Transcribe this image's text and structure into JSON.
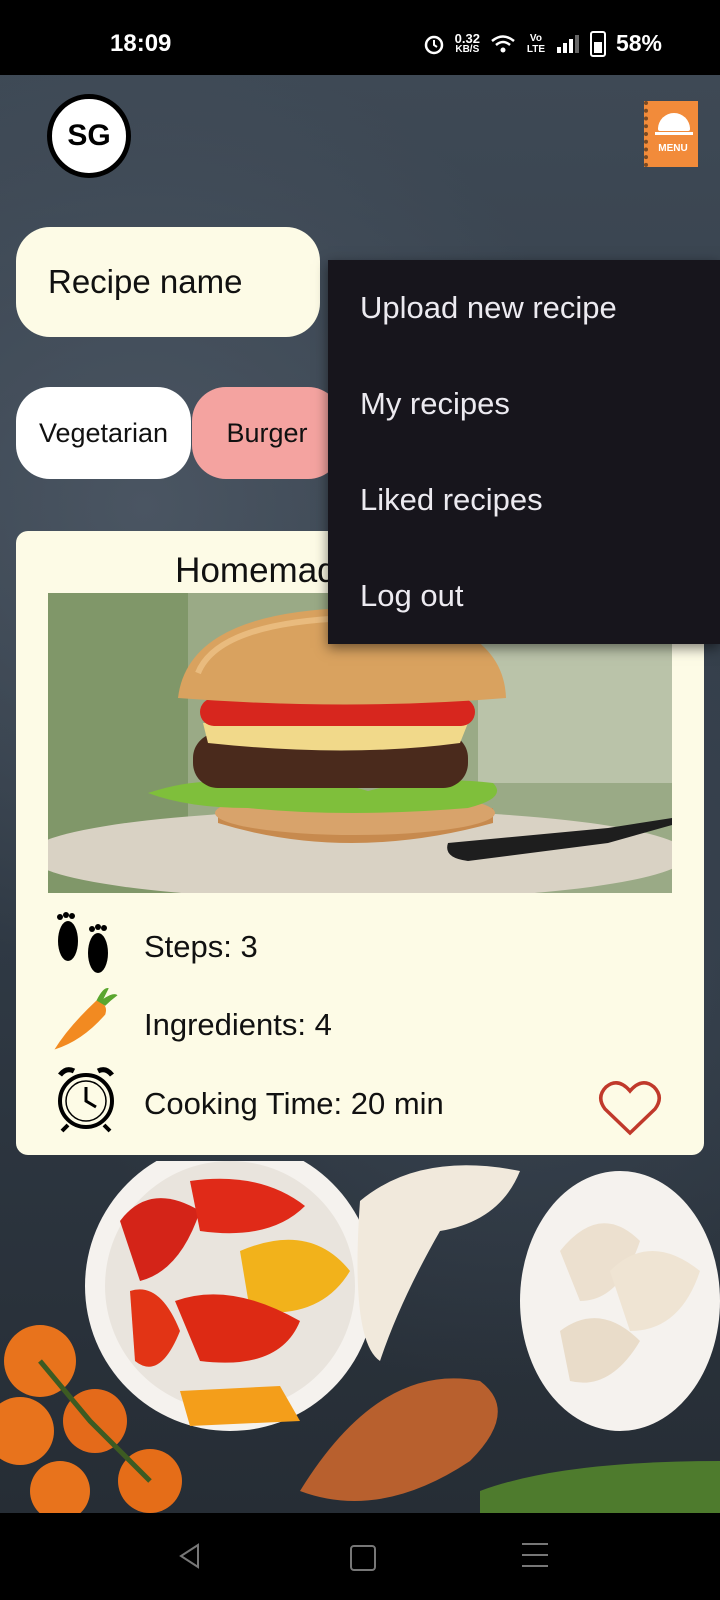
{
  "status_bar": {
    "time": "18:09",
    "speed_value": "0.32",
    "speed_unit": "KB/S",
    "network": "Vo LTE",
    "battery": "58%"
  },
  "header": {
    "avatar_initials": "SG",
    "menu_icon_label": "MENU"
  },
  "search": {
    "label": "Recipe name"
  },
  "filters": {
    "chips": [
      "Vegetarian",
      "Burger"
    ]
  },
  "recipe_card": {
    "title": "Homemade beef burger",
    "steps": "Steps: 3",
    "ingredients": "Ingredients: 4",
    "cooking_time": "Cooking Time: 20 min",
    "liked": false
  },
  "dropdown_menu": {
    "items": [
      "Upload new recipe",
      "My recipes",
      "Liked recipes",
      "Log out"
    ]
  },
  "colors": {
    "card_bg": "#fdfbe6",
    "menu_bg": "#17151c",
    "burger_chip": "#f4a3a0",
    "heart": "#c0392b",
    "menu_icon": "#f28b3a"
  }
}
